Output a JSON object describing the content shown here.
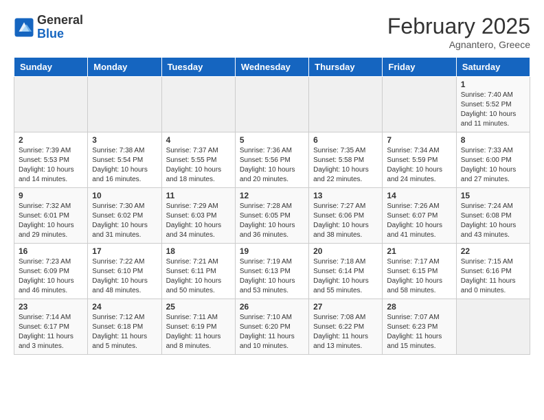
{
  "logo": {
    "general": "General",
    "blue": "Blue"
  },
  "title": {
    "month_year": "February 2025",
    "location": "Agnantero, Greece"
  },
  "days_of_week": [
    "Sunday",
    "Monday",
    "Tuesday",
    "Wednesday",
    "Thursday",
    "Friday",
    "Saturday"
  ],
  "weeks": [
    [
      {
        "day": "",
        "info": ""
      },
      {
        "day": "",
        "info": ""
      },
      {
        "day": "",
        "info": ""
      },
      {
        "day": "",
        "info": ""
      },
      {
        "day": "",
        "info": ""
      },
      {
        "day": "",
        "info": ""
      },
      {
        "day": "1",
        "info": "Sunrise: 7:40 AM\nSunset: 5:52 PM\nDaylight: 10 hours\nand 11 minutes."
      }
    ],
    [
      {
        "day": "2",
        "info": "Sunrise: 7:39 AM\nSunset: 5:53 PM\nDaylight: 10 hours\nand 14 minutes."
      },
      {
        "day": "3",
        "info": "Sunrise: 7:38 AM\nSunset: 5:54 PM\nDaylight: 10 hours\nand 16 minutes."
      },
      {
        "day": "4",
        "info": "Sunrise: 7:37 AM\nSunset: 5:55 PM\nDaylight: 10 hours\nand 18 minutes."
      },
      {
        "day": "5",
        "info": "Sunrise: 7:36 AM\nSunset: 5:56 PM\nDaylight: 10 hours\nand 20 minutes."
      },
      {
        "day": "6",
        "info": "Sunrise: 7:35 AM\nSunset: 5:58 PM\nDaylight: 10 hours\nand 22 minutes."
      },
      {
        "day": "7",
        "info": "Sunrise: 7:34 AM\nSunset: 5:59 PM\nDaylight: 10 hours\nand 24 minutes."
      },
      {
        "day": "8",
        "info": "Sunrise: 7:33 AM\nSunset: 6:00 PM\nDaylight: 10 hours\nand 27 minutes."
      }
    ],
    [
      {
        "day": "9",
        "info": "Sunrise: 7:32 AM\nSunset: 6:01 PM\nDaylight: 10 hours\nand 29 minutes."
      },
      {
        "day": "10",
        "info": "Sunrise: 7:30 AM\nSunset: 6:02 PM\nDaylight: 10 hours\nand 31 minutes."
      },
      {
        "day": "11",
        "info": "Sunrise: 7:29 AM\nSunset: 6:03 PM\nDaylight: 10 hours\nand 34 minutes."
      },
      {
        "day": "12",
        "info": "Sunrise: 7:28 AM\nSunset: 6:05 PM\nDaylight: 10 hours\nand 36 minutes."
      },
      {
        "day": "13",
        "info": "Sunrise: 7:27 AM\nSunset: 6:06 PM\nDaylight: 10 hours\nand 38 minutes."
      },
      {
        "day": "14",
        "info": "Sunrise: 7:26 AM\nSunset: 6:07 PM\nDaylight: 10 hours\nand 41 minutes."
      },
      {
        "day": "15",
        "info": "Sunrise: 7:24 AM\nSunset: 6:08 PM\nDaylight: 10 hours\nand 43 minutes."
      }
    ],
    [
      {
        "day": "16",
        "info": "Sunrise: 7:23 AM\nSunset: 6:09 PM\nDaylight: 10 hours\nand 46 minutes."
      },
      {
        "day": "17",
        "info": "Sunrise: 7:22 AM\nSunset: 6:10 PM\nDaylight: 10 hours\nand 48 minutes."
      },
      {
        "day": "18",
        "info": "Sunrise: 7:21 AM\nSunset: 6:11 PM\nDaylight: 10 hours\nand 50 minutes."
      },
      {
        "day": "19",
        "info": "Sunrise: 7:19 AM\nSunset: 6:13 PM\nDaylight: 10 hours\nand 53 minutes."
      },
      {
        "day": "20",
        "info": "Sunrise: 7:18 AM\nSunset: 6:14 PM\nDaylight: 10 hours\nand 55 minutes."
      },
      {
        "day": "21",
        "info": "Sunrise: 7:17 AM\nSunset: 6:15 PM\nDaylight: 10 hours\nand 58 minutes."
      },
      {
        "day": "22",
        "info": "Sunrise: 7:15 AM\nSunset: 6:16 PM\nDaylight: 11 hours\nand 0 minutes."
      }
    ],
    [
      {
        "day": "23",
        "info": "Sunrise: 7:14 AM\nSunset: 6:17 PM\nDaylight: 11 hours\nand 3 minutes."
      },
      {
        "day": "24",
        "info": "Sunrise: 7:12 AM\nSunset: 6:18 PM\nDaylight: 11 hours\nand 5 minutes."
      },
      {
        "day": "25",
        "info": "Sunrise: 7:11 AM\nSunset: 6:19 PM\nDaylight: 11 hours\nand 8 minutes."
      },
      {
        "day": "26",
        "info": "Sunrise: 7:10 AM\nSunset: 6:20 PM\nDaylight: 11 hours\nand 10 minutes."
      },
      {
        "day": "27",
        "info": "Sunrise: 7:08 AM\nSunset: 6:22 PM\nDaylight: 11 hours\nand 13 minutes."
      },
      {
        "day": "28",
        "info": "Sunrise: 7:07 AM\nSunset: 6:23 PM\nDaylight: 11 hours\nand 15 minutes."
      },
      {
        "day": "",
        "info": ""
      }
    ]
  ]
}
